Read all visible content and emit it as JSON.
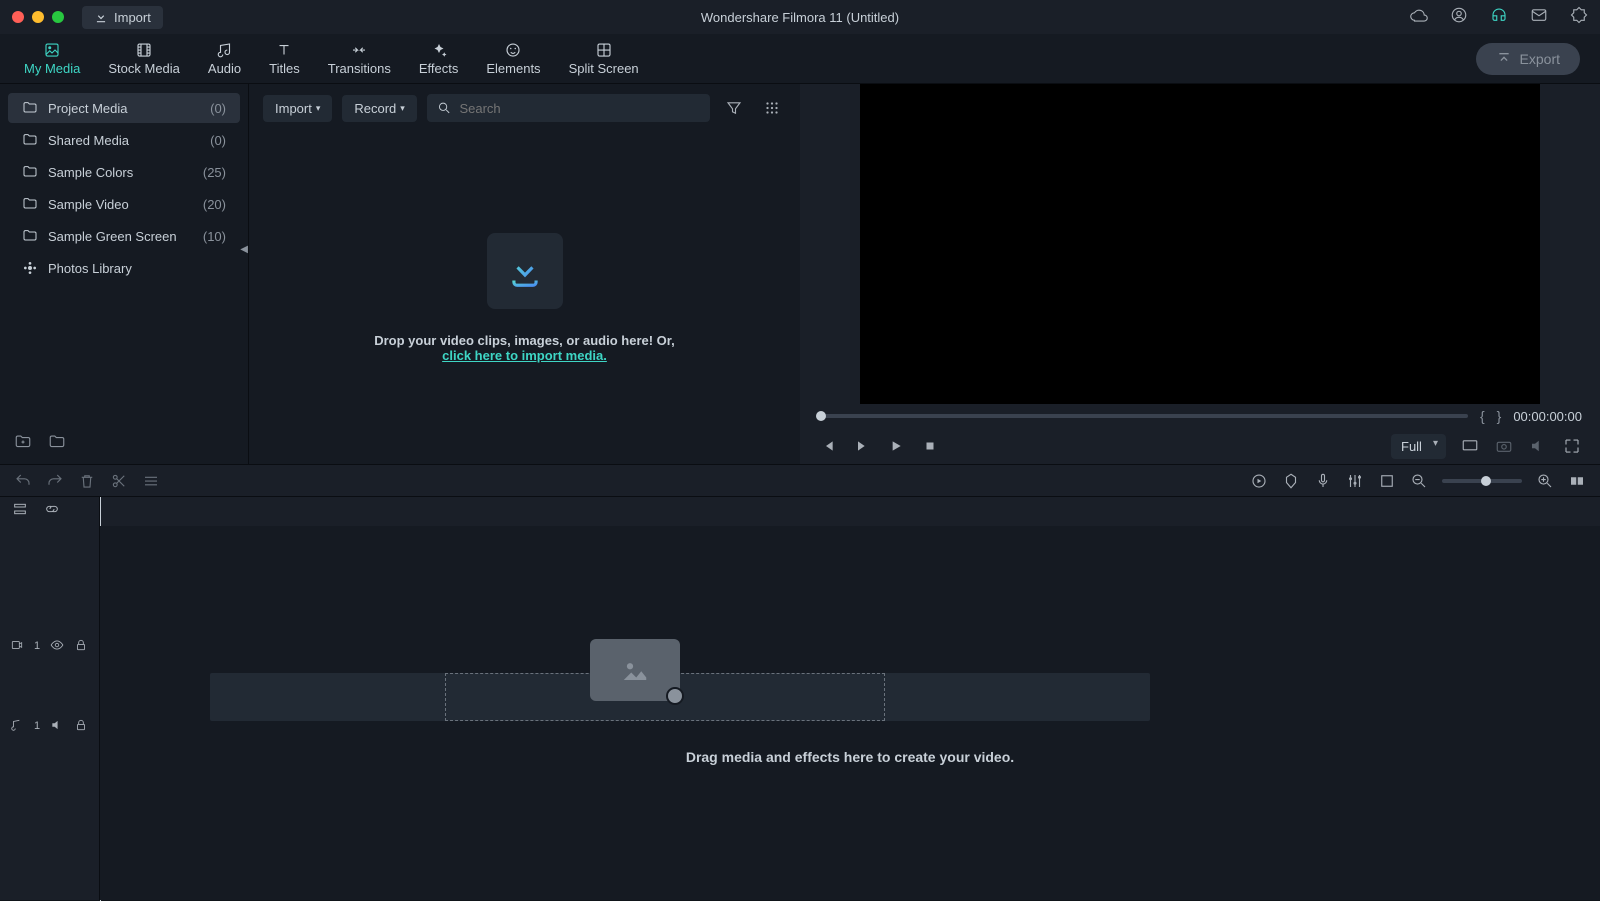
{
  "titlebar": {
    "import_label": "Import",
    "app_title": "Wondershare Filmora 11 (Untitled)"
  },
  "tabs": [
    {
      "label": "My Media"
    },
    {
      "label": "Stock Media"
    },
    {
      "label": "Audio"
    },
    {
      "label": "Titles"
    },
    {
      "label": "Transitions"
    },
    {
      "label": "Effects"
    },
    {
      "label": "Elements"
    },
    {
      "label": "Split Screen"
    }
  ],
  "export_label": "Export",
  "sidebar": {
    "items": [
      {
        "label": "Project Media",
        "count": "(0)"
      },
      {
        "label": "Shared Media",
        "count": "(0)"
      },
      {
        "label": "Sample Colors",
        "count": "(25)"
      },
      {
        "label": "Sample Video",
        "count": "(20)"
      },
      {
        "label": "Sample Green Screen",
        "count": "(10)"
      },
      {
        "label": "Photos Library",
        "count": ""
      }
    ]
  },
  "media_tools": {
    "import_dd": "Import",
    "record_dd": "Record",
    "search_placeholder": "Search"
  },
  "dropzone": {
    "text": "Drop your video clips, images, or audio here! Or,",
    "link": "click here to import media."
  },
  "preview": {
    "timecode": "00:00:00:00",
    "quality": "Full"
  },
  "timeline": {
    "video_track": "1",
    "audio_track": "1",
    "drop_text": "Drag media and effects here to create your video."
  }
}
